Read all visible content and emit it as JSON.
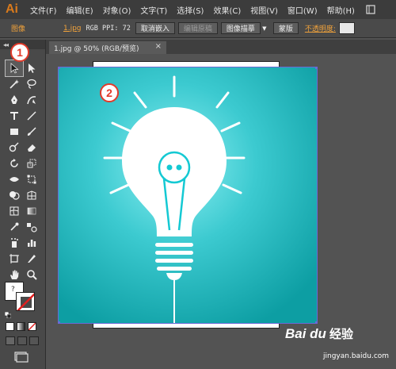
{
  "app": {
    "logo": "Ai"
  },
  "menu": {
    "items": [
      "文件(F)",
      "编辑(E)",
      "对象(O)",
      "文字(T)",
      "选择(S)",
      "效果(C)",
      "视图(V)",
      "窗口(W)",
      "帮助(H)"
    ]
  },
  "control_bar": {
    "object_type": "图像",
    "file_name": "1.jpg",
    "color_info": "RGB  PPI: 72",
    "buttons": {
      "cancel_embed": "取消嵌入",
      "edit_original": "编辑原稿",
      "image_trace": "图像描摹",
      "mask": "蒙版"
    },
    "opacity_label": "不透明度:"
  },
  "document": {
    "tab_title": "1.jpg @ 50% (RGB/预览)",
    "tab_close": "×"
  },
  "tools_panel": {
    "collapse": "◂◂"
  },
  "annotations": {
    "badge1": "1",
    "badge2": "2"
  },
  "watermark": {
    "brand": "Bai du",
    "product": "经验",
    "url": "jingyan.baidu.com"
  },
  "colors": {
    "accent": "#f0a23b",
    "badge_red": "#e23a2a",
    "teal_light": "#7de9ee",
    "teal_dark": "#0d9ea3",
    "ui_dark": "#3c3c3c"
  }
}
